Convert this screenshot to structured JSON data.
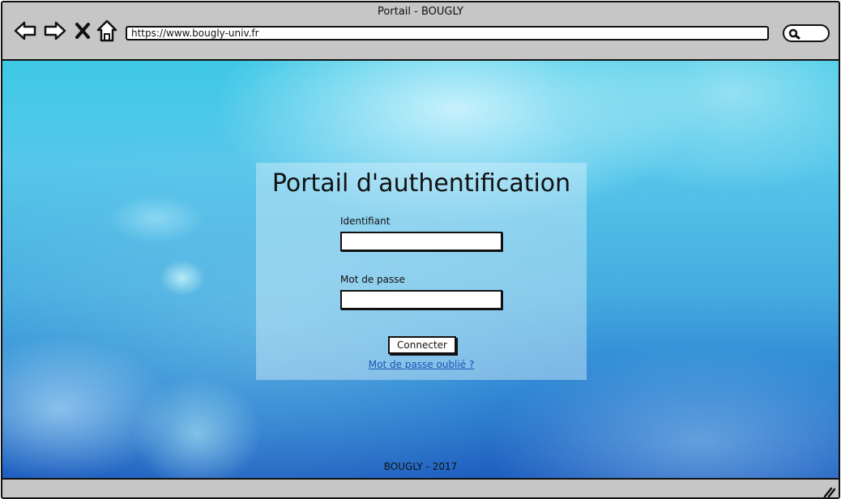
{
  "browser": {
    "title": "Portail - BOUGLY",
    "url": "https://www.bougly-univ.fr",
    "nav_icons": [
      "back-icon",
      "forward-icon",
      "close-icon",
      "home-icon"
    ],
    "search_icon": "search-icon"
  },
  "login": {
    "heading": "Portail d'authentification",
    "username_label": "Identifiant",
    "username_value": "",
    "password_label": "Mot de passe",
    "password_value": "",
    "submit_label": "Connecter",
    "forgot_link": "Mot de passe oublié ?"
  },
  "footer": {
    "text": "BOUGLY - 2017"
  },
  "colors": {
    "link": "#1a55b5",
    "chrome": "#c6c6c6",
    "background_top": "#3ec8e6",
    "background_bottom": "#1f5fc0"
  }
}
